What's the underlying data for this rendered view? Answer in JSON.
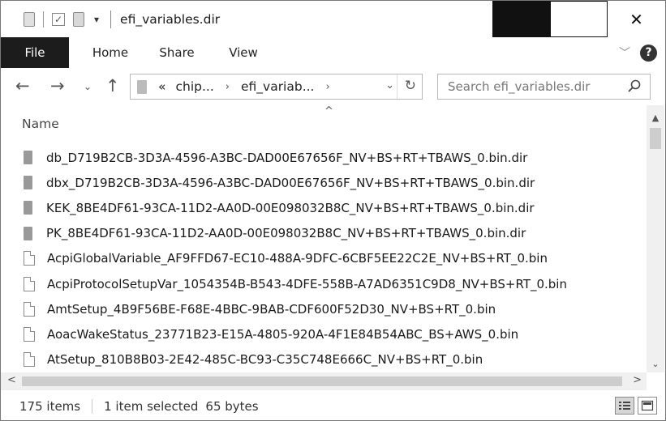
{
  "window": {
    "title": "efi_variables.dir",
    "controls": {
      "minimize": "minimize",
      "maximize": "maximize",
      "close": "✕"
    }
  },
  "ribbon": {
    "tabs": [
      {
        "label": "File",
        "active": true
      },
      {
        "label": "Home"
      },
      {
        "label": "Share"
      },
      {
        "label": "View"
      }
    ],
    "help": "?"
  },
  "address_bar": {
    "overflow": "«",
    "crumbs": [
      "chip...",
      "efi_variab..."
    ]
  },
  "search": {
    "placeholder": "Search efi_variables.dir"
  },
  "file_list": {
    "column_header": "Name",
    "items": [
      {
        "name": "db_D719B2CB-3D3A-4596-A3BC-DAD00E67656F_NV+BS+RT+TBAWS_0.bin.dir",
        "type": "folder"
      },
      {
        "name": "dbx_D719B2CB-3D3A-4596-A3BC-DAD00E67656F_NV+BS+RT+TBAWS_0.bin.dir",
        "type": "folder"
      },
      {
        "name": "KEK_8BE4DF61-93CA-11D2-AA0D-00E098032B8C_NV+BS+RT+TBAWS_0.bin.dir",
        "type": "folder"
      },
      {
        "name": "PK_8BE4DF61-93CA-11D2-AA0D-00E098032B8C_NV+BS+RT+TBAWS_0.bin.dir",
        "type": "folder"
      },
      {
        "name": "AcpiGlobalVariable_AF9FFD67-EC10-488A-9DFC-6CBF5EE22C2E_NV+BS+RT_0.bin",
        "type": "file"
      },
      {
        "name": "AcpiProtocolSetupVar_1054354B-B543-4DFE-558B-A7AD6351C9D8_NV+BS+RT_0.bin",
        "type": "file"
      },
      {
        "name": "AmtSetup_4B9F56BE-F68E-4BBC-9BAB-CDF600F52D30_NV+BS+RT_0.bin",
        "type": "file"
      },
      {
        "name": "AoacWakeStatus_23771B23-E15A-4805-920A-4F1E84B54ABC_BS+AWS_0.bin",
        "type": "file"
      },
      {
        "name": "AtSetup_810B8B03-2E42-485C-BC93-C35C748E666C_NV+BS+RT_0.bin",
        "type": "file"
      }
    ]
  },
  "status_bar": {
    "item_count": "175 items",
    "selection": "1 item selected",
    "size": "65 bytes"
  },
  "icons": {
    "back": "arrow-left-icon",
    "forward": "arrow-right-icon",
    "recent": "chevron-down-icon",
    "up": "arrow-up-icon",
    "refresh": "refresh-icon",
    "search": "magnifier-icon"
  }
}
